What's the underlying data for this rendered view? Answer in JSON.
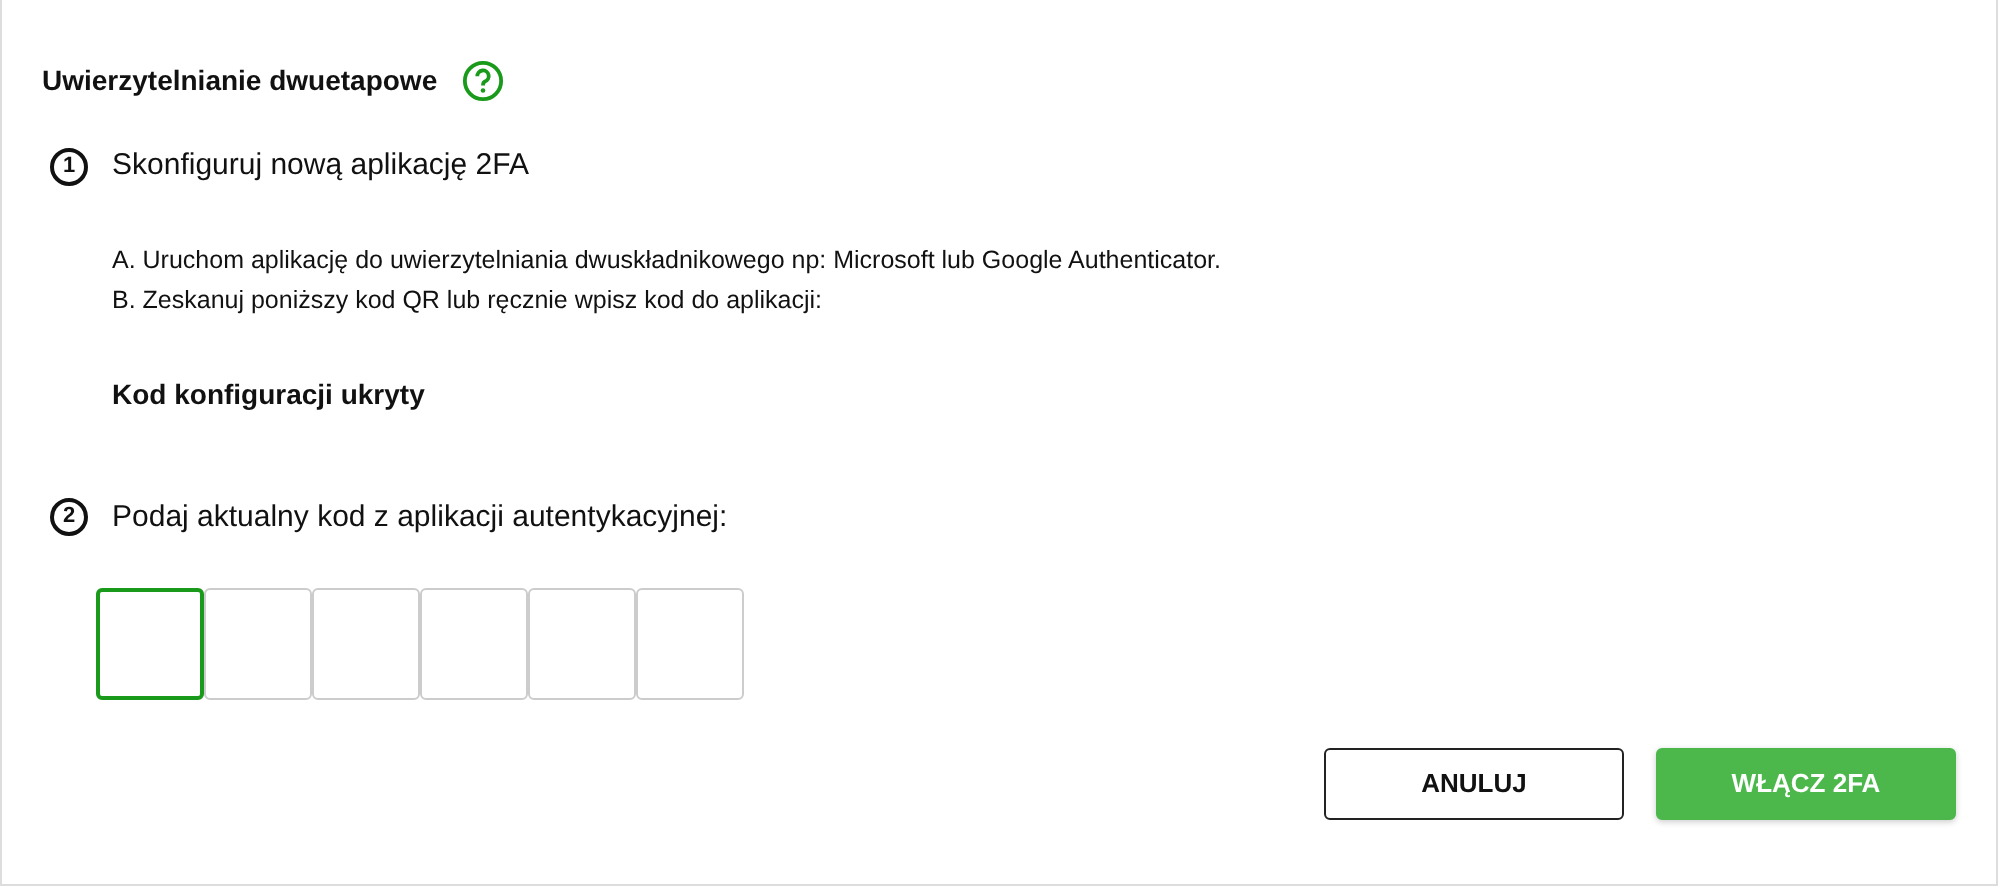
{
  "title": "Uwierzytelnianie dwuetapowe",
  "steps": [
    {
      "number": "1",
      "text": "Skonfiguruj nową aplikację 2FA",
      "lines": [
        "A. Uruchom aplikację do uwierzytelniania dwuskładnikowego np: Microsoft lub Google Authenticator.",
        "B. Zeskanuj poniższy kod QR lub ręcznie wpisz kod do aplikacji:"
      ],
      "note": "Kod konfiguracji ukryty"
    },
    {
      "number": "2",
      "text": "Podaj aktualny kod z aplikacji autentykacyjnej:"
    }
  ],
  "code_inputs": [
    {
      "focused": true
    },
    {
      "focused": false
    },
    {
      "focused": false
    },
    {
      "focused": false
    },
    {
      "focused": false
    },
    {
      "focused": false
    }
  ],
  "buttons": [
    {
      "label": "ANULUJ",
      "kind": "secondary"
    },
    {
      "label": "WŁĄCZ 2FA",
      "kind": "primary"
    }
  ]
}
